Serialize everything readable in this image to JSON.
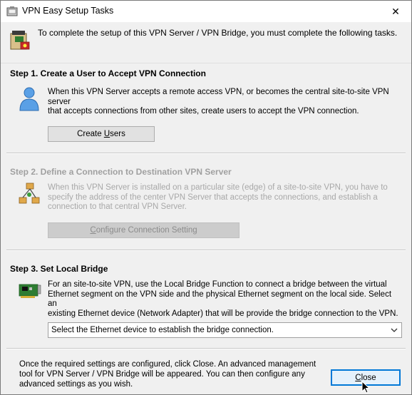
{
  "window": {
    "title": "VPN Easy Setup Tasks",
    "close_glyph": "✕"
  },
  "header": {
    "text": "To complete the setup of this VPN Server / VPN Bridge, you must complete the following tasks."
  },
  "step1": {
    "title": "Step 1. Create a User to Accept VPN Connection",
    "desc_line1": "When this VPN Server accepts a remote access VPN, or becomes the central site-to-site VPN server",
    "desc_line2": "that accepts connections from other sites, create users to accept the VPN connection.",
    "button_pre": "Create ",
    "button_u": "U",
    "button_post": "sers"
  },
  "step2": {
    "title": "Step 2. Define a Connection to Destination VPN Server",
    "desc_line1": "When this VPN Server is installed on a particular site (edge) of a site-to-site VPN, you have to",
    "desc_line2": "specify the address of the center VPN Server that accepts the connections, and establish a",
    "desc_line3": "connection to that central VPN Server.",
    "button_u": "C",
    "button_post": "onfigure Connection Setting"
  },
  "step3": {
    "title": "Step 3. Set Local Bridge",
    "desc_line1": "For an site-to-site VPN, use the Local Bridge Function to connect a bridge between the virtual",
    "desc_line2": "Ethernet segment on the VPN side and the physical Ethernet segment on the local side. Select an",
    "desc_line3": "existing Ethernet device (Network Adapter) that will be provide the bridge connection to the VPN.",
    "combo_value": "Select the Ethernet device to establish the bridge connection."
  },
  "footer": {
    "line1": "Once the required settings are configured, click Close. An advanced management",
    "line2": "tool for VPN Server / VPN Bridge will be appeared. You can then configure any",
    "line3": "advanced settings as you wish.",
    "close_u": "C",
    "close_post": "lose"
  }
}
